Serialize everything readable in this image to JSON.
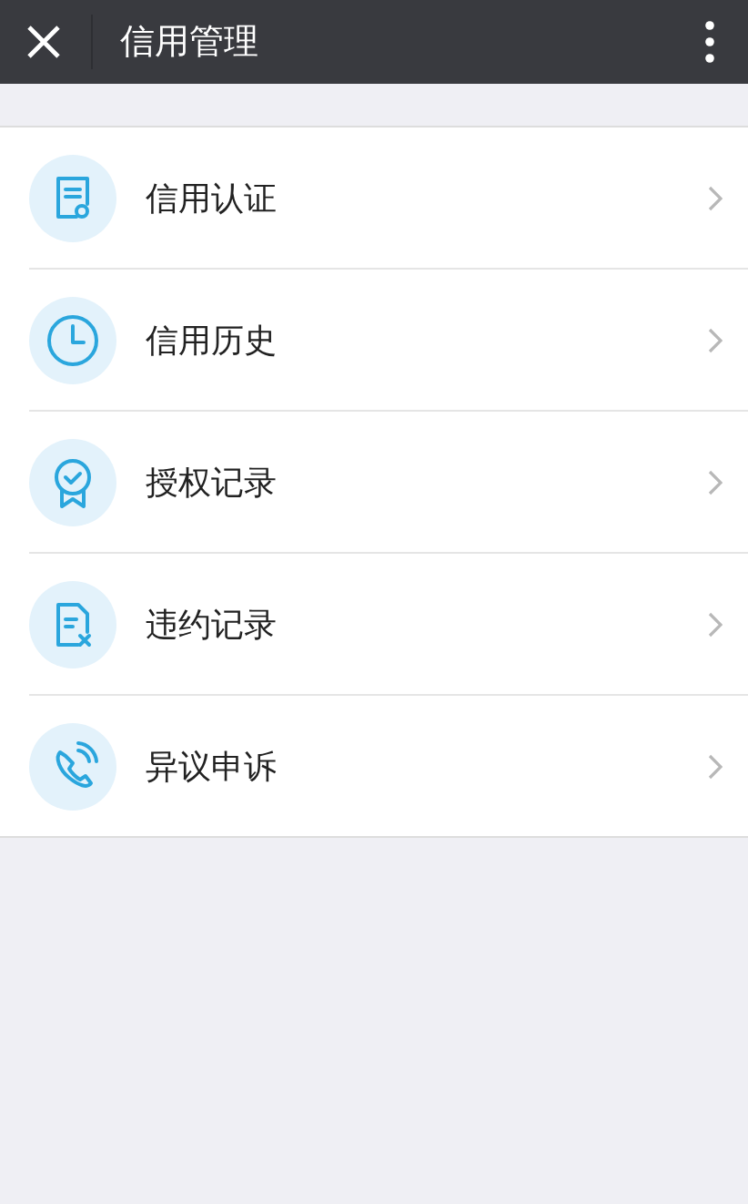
{
  "header": {
    "title": "信用管理"
  },
  "menu": [
    {
      "label": "信用认证",
      "kind": "certificate"
    },
    {
      "label": "信用历史",
      "kind": "history"
    },
    {
      "label": "授权记录",
      "kind": "authorization"
    },
    {
      "label": "违约记录",
      "kind": "default"
    },
    {
      "label": "异议申诉",
      "kind": "appeal"
    }
  ]
}
